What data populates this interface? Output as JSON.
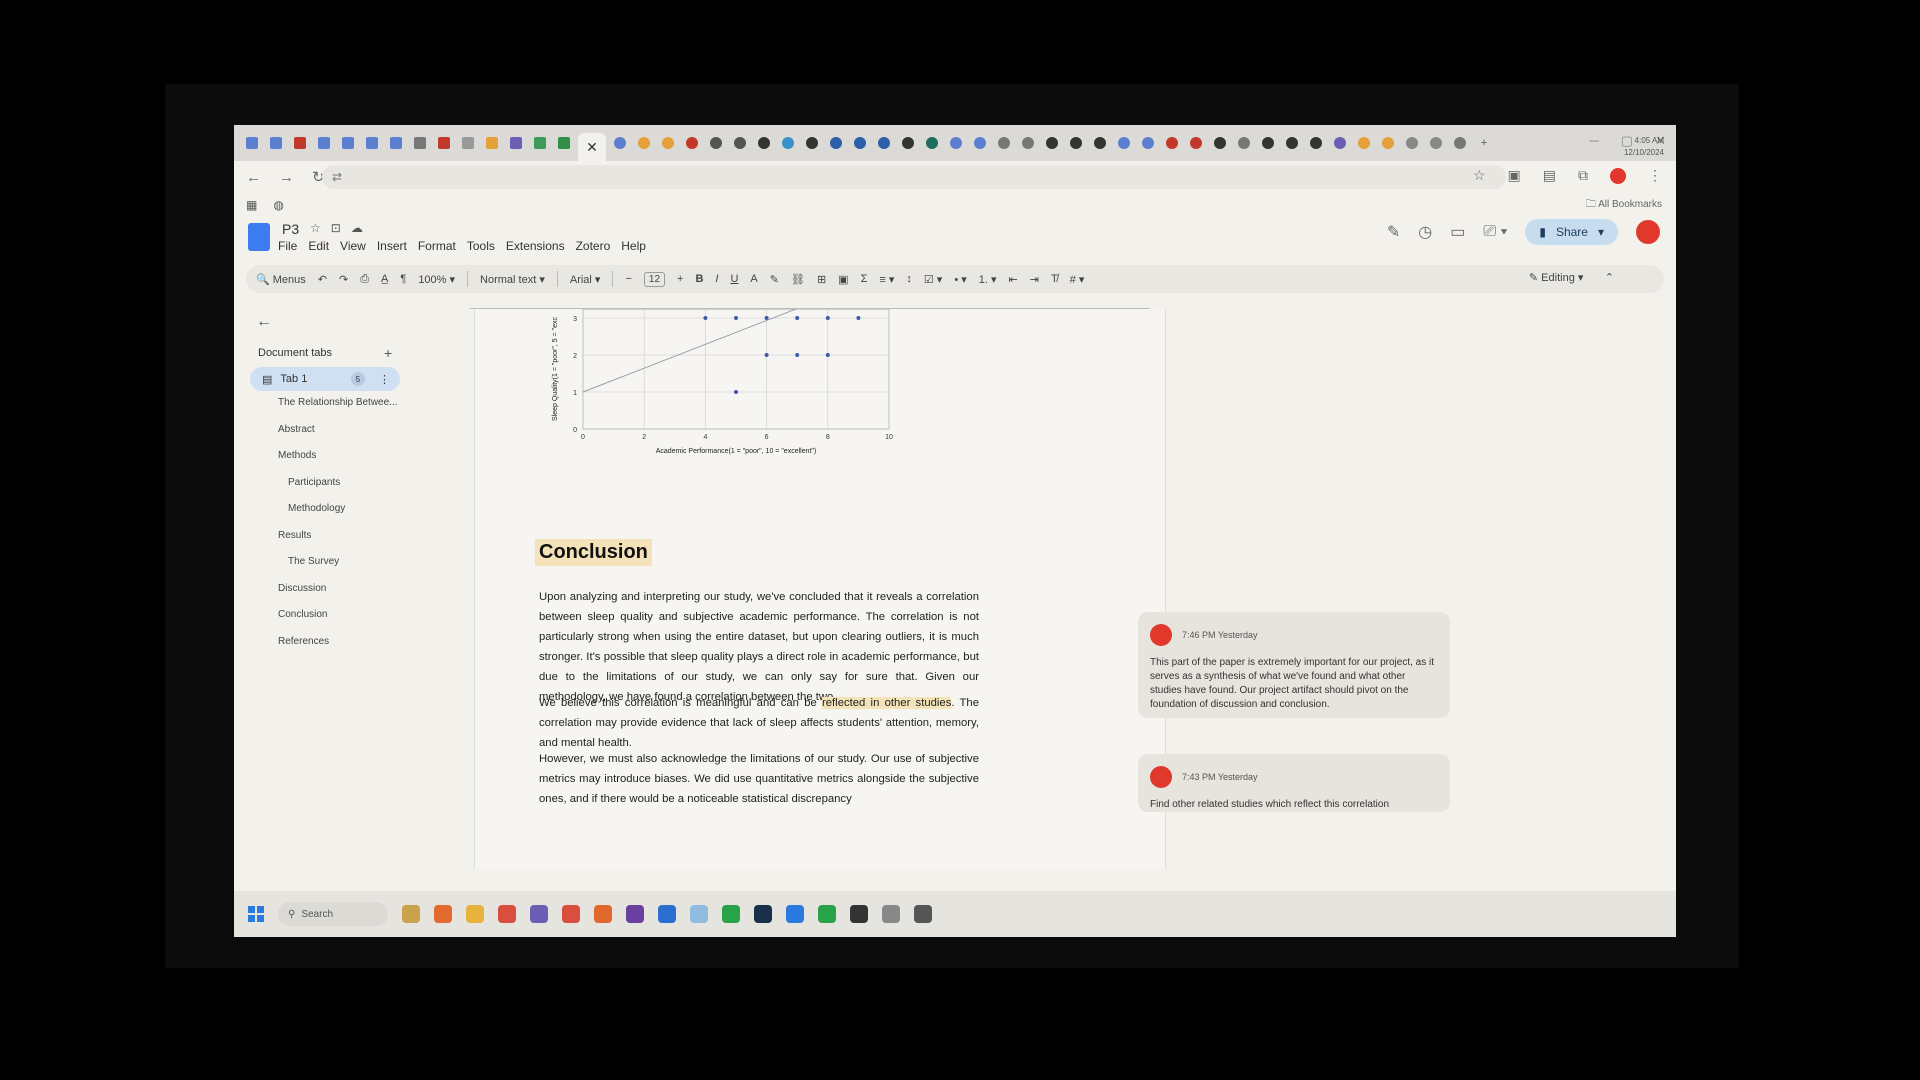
{
  "browser": {
    "tab_count_icons": 60,
    "active_tab_close": "✕",
    "bookmarks_right": "All Bookmarks"
  },
  "docs": {
    "title": "P3",
    "menu": [
      "File",
      "Edit",
      "View",
      "Insert",
      "Format",
      "Tools",
      "Extensions",
      "Zotero",
      "Help"
    ],
    "share_label": "Share"
  },
  "toolbar": {
    "menus_label": "Menus",
    "zoom": "100%",
    "style": "Normal text",
    "font": "Arial",
    "font_size": "12",
    "editing": "Editing"
  },
  "sidebar": {
    "title": "Document tabs",
    "tab_label": "Tab 1",
    "tab_badge": "5",
    "outline": [
      {
        "label": "The Relationship Betwee...",
        "level": 0
      },
      {
        "label": "Abstract",
        "level": 0
      },
      {
        "label": "Methods",
        "level": 0
      },
      {
        "label": "Participants",
        "level": 1
      },
      {
        "label": "Methodology",
        "level": 1
      },
      {
        "label": "Results",
        "level": 0
      },
      {
        "label": "The Survey",
        "level": 1
      },
      {
        "label": "Discussion",
        "level": 0
      },
      {
        "label": "Conclusion",
        "level": 0
      },
      {
        "label": "References",
        "level": 0
      }
    ]
  },
  "chart_data": {
    "type": "scatter",
    "xlabel": "Academic Performance(1 = \"poor\", 10 = \"excellent\")",
    "ylabel": "Sleep Quality(1 = \"poor\", 5 = \"exc",
    "xlim": [
      0,
      10
    ],
    "ylim": [
      0,
      4
    ],
    "x_ticks": [
      0,
      2,
      4,
      6,
      8,
      10
    ],
    "y_ticks": [
      0,
      1,
      2,
      3
    ],
    "points": [
      {
        "x": 4,
        "y": 3
      },
      {
        "x": 5,
        "y": 3
      },
      {
        "x": 6,
        "y": 3
      },
      {
        "x": 7,
        "y": 3
      },
      {
        "x": 8,
        "y": 3
      },
      {
        "x": 9,
        "y": 3
      },
      {
        "x": 6,
        "y": 2
      },
      {
        "x": 7,
        "y": 2
      },
      {
        "x": 8,
        "y": 2
      },
      {
        "x": 5,
        "y": 1
      }
    ],
    "trendline": [
      {
        "x": 0,
        "y": 1
      },
      {
        "x": 9,
        "y": 3.9
      }
    ]
  },
  "document": {
    "heading": "Conclusion",
    "p1": "Upon analyzing and interpreting our study, we've concluded that it reveals a correlation between sleep quality and subjective academic performance. The correlation is not particularly strong when using the entire dataset, but upon clearing outliers, it is much stronger. It's possible that sleep quality plays a direct role in academic performance, but due to the limitations of our study, we can only say for sure that. Given our methodology, we have found a correlation between the two.",
    "p2_a": "We believe this correlation is meaningful and can be ",
    "p2_hl": "reflected in other studies",
    "p2_b": ". The correlation may provide evidence that lack of sleep affects students' attention, memory, and mental health.",
    "p3": "However, we must also acknowledge the limitations of our study. Our use of subjective metrics may introduce biases. We did use quantitative metrics alongside the subjective ones, and if there would be a noticeable statistical discrepancy"
  },
  "comments": [
    {
      "time": "7:46 PM Yesterday",
      "text": "This part of the paper is extremely important for our project, as it serves as a synthesis of what we've found and what other studies have found. Our project artifact should pivot on the foundation of discussion and conclusion."
    },
    {
      "time": "7:43 PM Yesterday",
      "text": "Find other related studies which reflect this correlation"
    }
  ],
  "taskbar": {
    "search_label": "Search",
    "time": "4:05 AM",
    "date": "12/10/2024"
  },
  "colors": {
    "accent": "#3b7cf0",
    "avatar": "#e0382a",
    "highlight": "#f4e3b8"
  }
}
